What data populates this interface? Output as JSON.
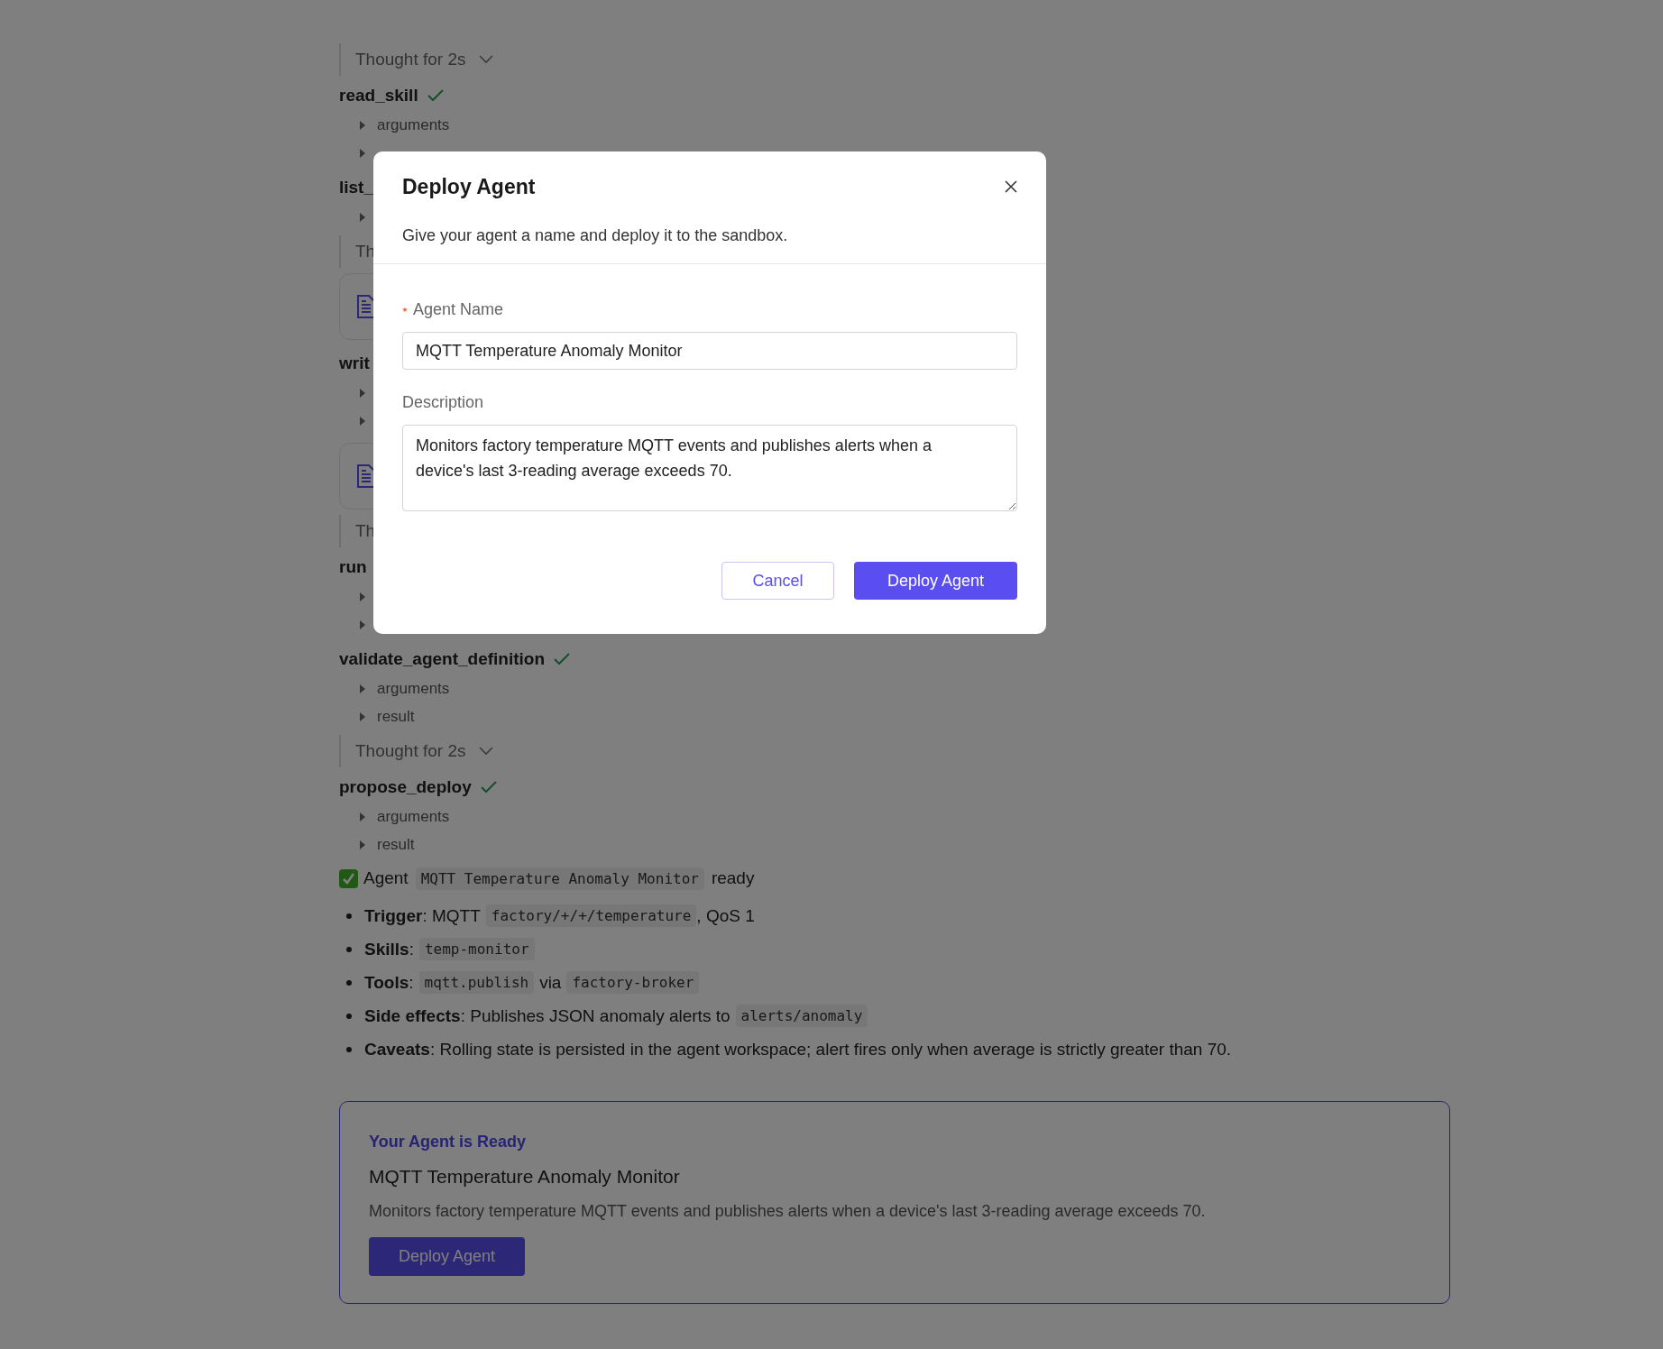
{
  "transcript": [
    {
      "kind": "thought",
      "label": "Thought for 2s",
      "chevron": true
    },
    {
      "kind": "tool",
      "name": "read_skill",
      "done": true,
      "rows": [
        {
          "label": "arguments"
        },
        {}
      ]
    },
    {
      "kind": "tool",
      "name": "list_",
      "done": false,
      "rows": [
        {}
      ]
    },
    {
      "kind": "thought",
      "label": "Th",
      "chevron": false
    },
    {
      "kind": "file_card"
    },
    {
      "kind": "tool",
      "name": "writ",
      "done": false,
      "rows": [
        {},
        {}
      ]
    },
    {
      "kind": "file_card"
    },
    {
      "kind": "thought",
      "label": "Th",
      "chevron": false
    },
    {
      "kind": "tool",
      "name": "run",
      "done": false,
      "rows": [
        {},
        {}
      ]
    },
    {
      "kind": "tool",
      "name": "validate_agent_definition",
      "done": true,
      "rows": [
        {
          "label": "arguments"
        },
        {
          "label": "result"
        }
      ]
    },
    {
      "kind": "thought",
      "label": "Thought for 2s",
      "chevron": true
    },
    {
      "kind": "tool",
      "name": "propose_deploy",
      "done": true,
      "rows": [
        {
          "label": "arguments"
        },
        {
          "label": "result"
        }
      ]
    }
  ],
  "summary": {
    "status_line": [
      {
        "kind": "text",
        "text": "Agent"
      },
      {
        "kind": "code",
        "text": "MQTT Temperature Anomaly Monitor"
      },
      {
        "kind": "text",
        "text": "ready"
      }
    ],
    "bullets": [
      {
        "parts": [
          {
            "kind": "label",
            "text": "Trigger"
          },
          {
            "kind": "continuation",
            "text": ": MQTT"
          },
          {
            "kind": "code",
            "text": "factory/+/+/temperature"
          },
          {
            "kind": "continuation",
            "text": ", QoS 1"
          }
        ]
      },
      {
        "parts": [
          {
            "kind": "label",
            "text": "Skills"
          },
          {
            "kind": "continuation",
            "text": ":"
          },
          {
            "kind": "code",
            "text": "temp-monitor"
          }
        ]
      },
      {
        "parts": [
          {
            "kind": "label",
            "text": "Tools"
          },
          {
            "kind": "continuation",
            "text": ":"
          },
          {
            "kind": "code",
            "text": "mqtt.publish"
          },
          {
            "kind": "text",
            "text": "via"
          },
          {
            "kind": "code",
            "text": "factory-broker"
          }
        ]
      },
      {
        "parts": [
          {
            "kind": "label",
            "text": "Side effects"
          },
          {
            "kind": "continuation",
            "text": ": Publishes JSON anomaly alerts to"
          },
          {
            "kind": "code",
            "text": "alerts/anomaly"
          }
        ]
      },
      {
        "parts": [
          {
            "kind": "label",
            "text": "Caveats"
          },
          {
            "kind": "continuation",
            "text": ": Rolling state is persisted in the agent workspace; alert fires only when average is strictly greater than 70."
          }
        ]
      }
    ]
  },
  "ready_card": {
    "kicker": "Your Agent is Ready",
    "title": "MQTT Temperature Anomaly Monitor",
    "description": "Monitors factory temperature MQTT events and publishes alerts when a device's last 3-reading average exceeds 70.",
    "button": "Deploy Agent"
  },
  "dialog": {
    "title": "Deploy Agent",
    "subtitle": "Give your agent a name and deploy it to the sandbox.",
    "fields": [
      {
        "kind": "input",
        "label": "Agent Name",
        "required": true,
        "value": "MQTT Temperature Anomaly Monitor"
      },
      {
        "kind": "textarea",
        "label": "Description",
        "required": false,
        "value": "Monitors factory temperature MQTT events and publishes alerts when a device's last 3-reading average exceeds 70."
      }
    ],
    "buttons": [
      {
        "kind": "secondary",
        "label": "Cancel"
      },
      {
        "kind": "primary",
        "label": "Deploy Agent"
      }
    ]
  }
}
